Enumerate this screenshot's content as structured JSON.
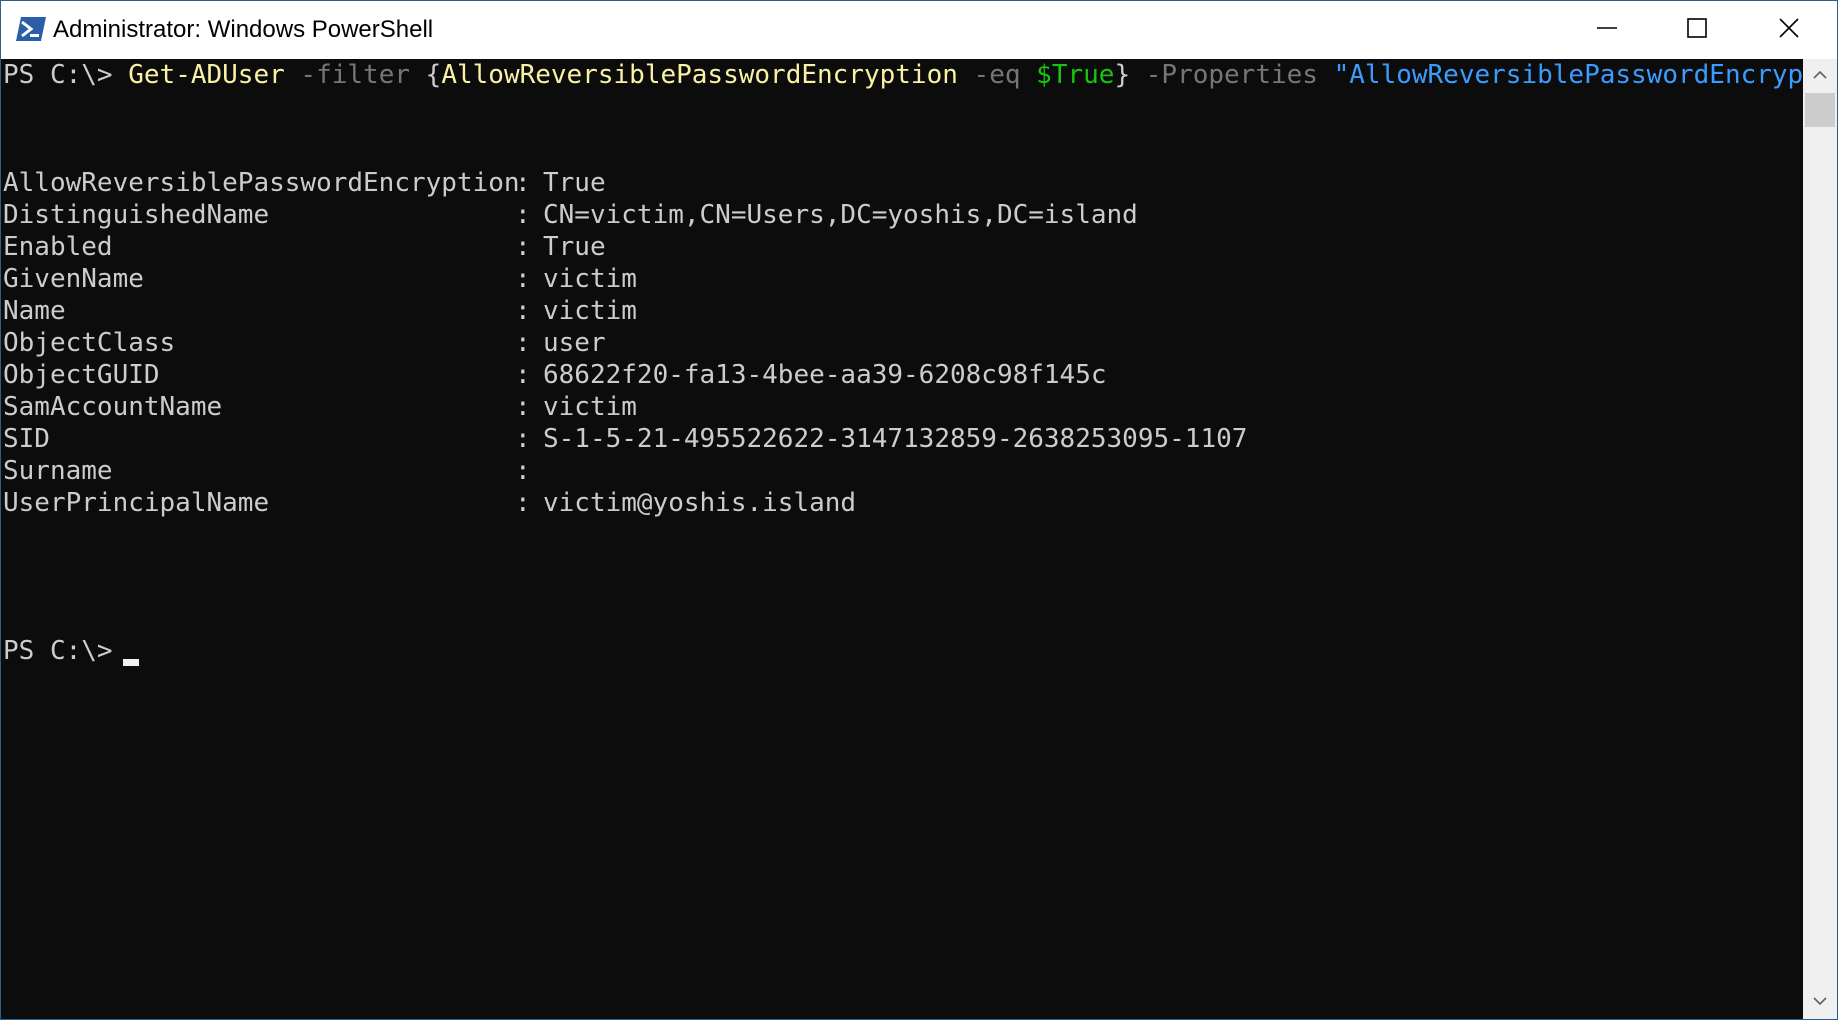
{
  "window": {
    "title": "Administrator: Windows PowerShell",
    "icon": "powershell-icon",
    "controls": {
      "minimize_icon": "minimize-icon",
      "maximize_icon": "maximize-icon",
      "close_icon": "close-icon"
    }
  },
  "console": {
    "command_line": {
      "prompt": "PS C:\\> ",
      "cmdlet": "Get-ADUser",
      "param_filter": " -filter ",
      "filter_open": "{",
      "filter_property": "AllowReversiblePasswordEncryption",
      "operator": " -eq ",
      "filter_value": "$True",
      "filter_close": "}",
      "param_properties": " -Properties ",
      "properties_value": "\"AllowReversiblePasswordEncryption\""
    },
    "output": [
      {
        "name": "AllowReversiblePasswordEncryption",
        "sep": ":",
        "value": "True"
      },
      {
        "name": "DistinguishedName",
        "sep": ":",
        "value": "CN=victim,CN=Users,DC=yoshis,DC=island"
      },
      {
        "name": "Enabled",
        "sep": ":",
        "value": "True"
      },
      {
        "name": "GivenName",
        "sep": ":",
        "value": "victim"
      },
      {
        "name": "Name",
        "sep": ":",
        "value": "victim"
      },
      {
        "name": "ObjectClass",
        "sep": ":",
        "value": "user"
      },
      {
        "name": "ObjectGUID",
        "sep": ":",
        "value": "68622f20-fa13-4bee-aa39-6208c98f145c"
      },
      {
        "name": "SamAccountName",
        "sep": ":",
        "value": "victim"
      },
      {
        "name": "SID",
        "sep": ":",
        "value": "S-1-5-21-495522622-3147132859-2638253095-1107"
      },
      {
        "name": "Surname",
        "sep": ":",
        "value": ""
      },
      {
        "name": "UserPrincipalName",
        "sep": ":",
        "value": "victim@yoshis.island"
      }
    ],
    "final_prompt": "PS C:\\> "
  },
  "colors": {
    "background": "#0c0c0c",
    "text": "#cccccc",
    "cmdlet": "#f9f1a5",
    "parameter": "#767676",
    "variable": "#16c60c",
    "string": "#3b9cff"
  },
  "scrollbar": {
    "up_icon": "scroll-up-arrow-icon",
    "down_icon": "scroll-down-arrow-icon"
  }
}
